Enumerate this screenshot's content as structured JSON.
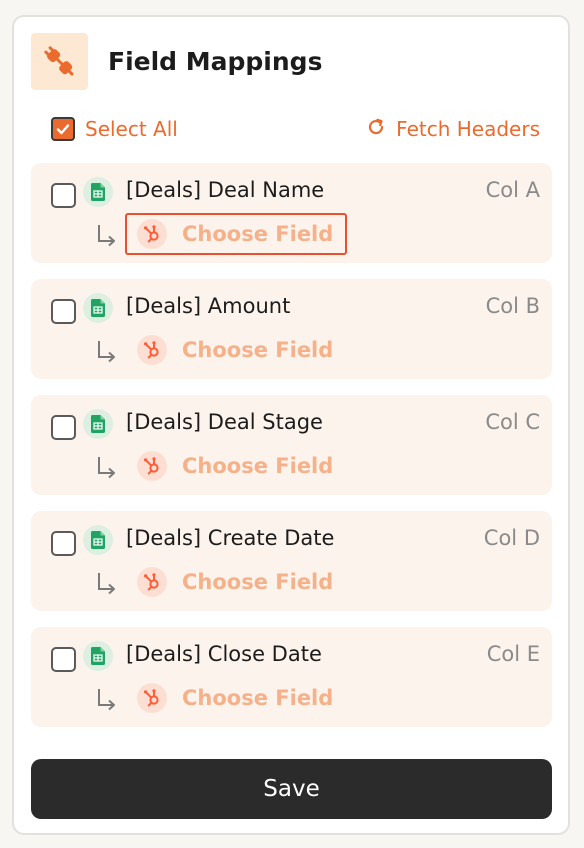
{
  "header": {
    "title": "Field Mappings",
    "icon": "plug-icon"
  },
  "toolbar": {
    "select_all_label": "Select All",
    "select_all_checked": true,
    "fetch_label": "Fetch Headers"
  },
  "rows": [
    {
      "field": "[Deals] Deal Name",
      "col": "Col A",
      "target": "Choose Field",
      "checked": false
    },
    {
      "field": "[Deals] Amount",
      "col": "Col B",
      "target": "Choose Field",
      "checked": false
    },
    {
      "field": "[Deals] Deal Stage",
      "col": "Col C",
      "target": "Choose Field",
      "checked": false
    },
    {
      "field": "[Deals] Create Date",
      "col": "Col D",
      "target": "Choose Field",
      "checked": false
    },
    {
      "field": "[Deals] Close Date",
      "col": "Col E",
      "target": "Choose Field",
      "checked": false
    }
  ],
  "save_label": "Save",
  "colors": {
    "accent": "#ea6b2d",
    "choose_field_text": "#f5b18a",
    "row_background": "#fdf3ed",
    "save_button": "#2b2b2b",
    "highlight_border": "#e8502f"
  }
}
